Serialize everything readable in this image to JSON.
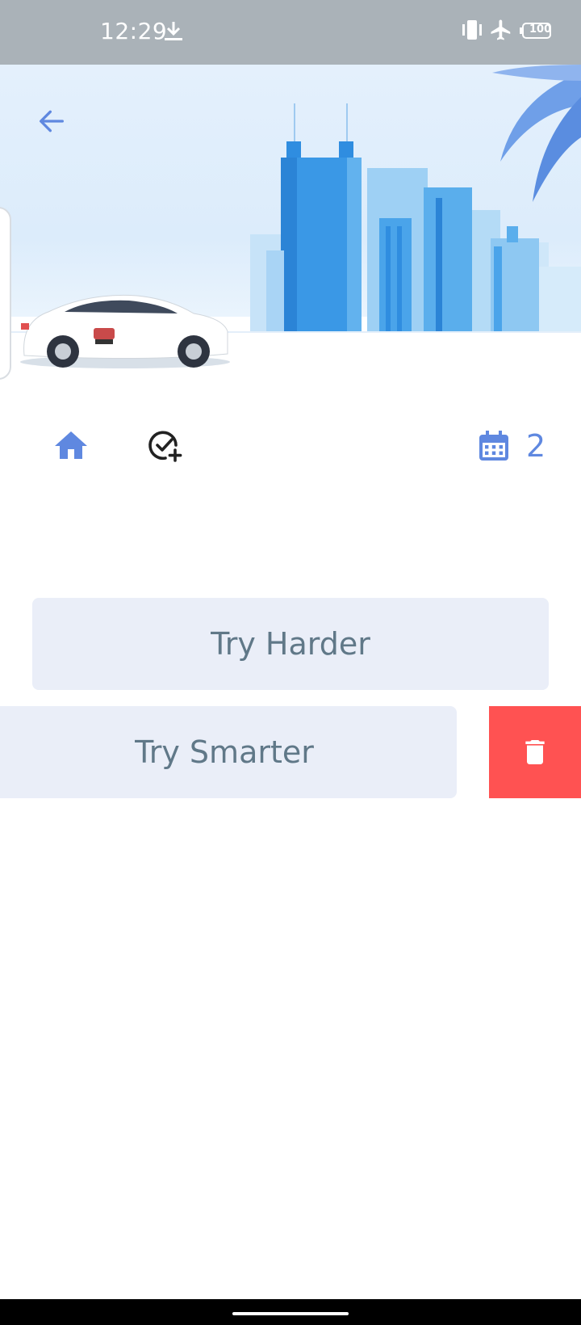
{
  "status_bar": {
    "time": "12:29",
    "battery_level": "100",
    "icons": [
      "download-icon",
      "vibrate-icon",
      "airplane-mode-icon",
      "battery-icon"
    ]
  },
  "header": {
    "icons": [
      "back-arrow-icon"
    ],
    "illustration": "city-skyline-with-car"
  },
  "toolbar": {
    "icons": [
      "home-icon",
      "check-circle-add-icon",
      "calendar-icon"
    ],
    "calendar_count": "2"
  },
  "tasks": [
    {
      "label": "Try Harder"
    },
    {
      "label": "Try Smarter"
    }
  ],
  "swipe_action": {
    "icon": "trash-icon",
    "color": "#ff5252"
  },
  "colors": {
    "accent": "#5f88e0",
    "card_bg": "#eaeef8",
    "card_text": "#607888",
    "status_bar": "#aab2b8"
  }
}
